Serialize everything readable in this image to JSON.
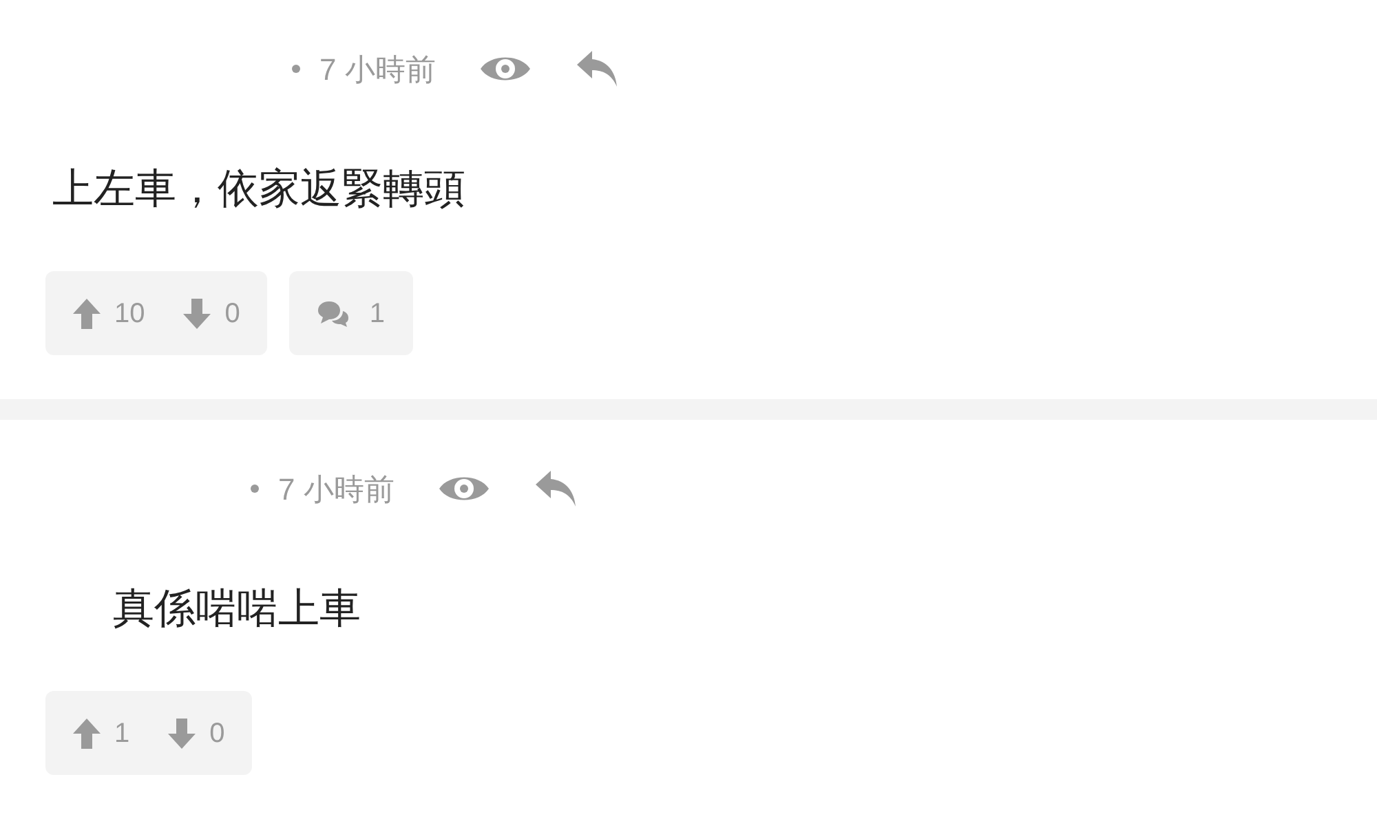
{
  "comments": [
    {
      "kind": "top",
      "time": "7 小時前",
      "text": "上左車，依家返緊轉頭",
      "upvotes": "10",
      "downvotes": "0",
      "replies": "1"
    },
    {
      "kind": "reply",
      "time": "7 小時前",
      "text": "真係啱啱上車",
      "upvotes": "1",
      "downvotes": "0"
    }
  ]
}
